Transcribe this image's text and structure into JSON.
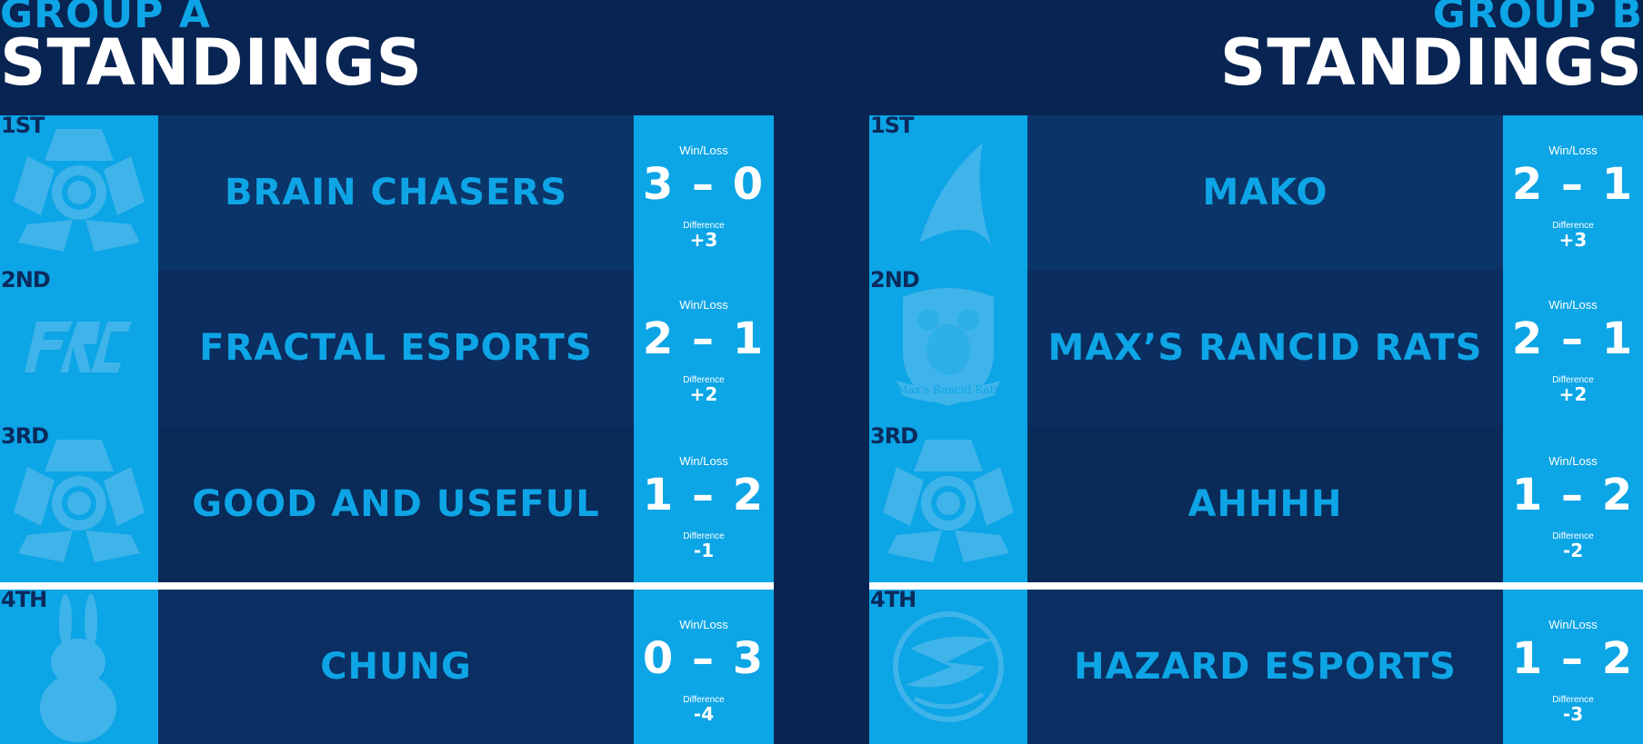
{
  "group_a": {
    "subtitle": "GROUP A",
    "title": "STANDINGS",
    "standings": [
      {
        "rank": "1ST",
        "team": "BRAIN CHASERS",
        "wl_label": "Win/Loss",
        "wins": "3",
        "losses": "0",
        "diff_label": "Difference",
        "diff": "+3",
        "logo_icon": "rocket-league-logo-icon"
      },
      {
        "rank": "2ND",
        "team": "FRACTAL ESPORTS",
        "wl_label": "Win/Loss",
        "wins": "2",
        "losses": "1",
        "diff_label": "Difference",
        "diff": "+2",
        "logo_icon": "frc-logo-icon"
      },
      {
        "rank": "3RD",
        "team": "GOOD AND USEFUL",
        "wl_label": "Win/Loss",
        "wins": "1",
        "losses": "2",
        "diff_label": "Difference",
        "diff": "-1",
        "logo_icon": "rocket-league-logo-icon"
      },
      {
        "rank": "4TH",
        "team": "CHUNG",
        "wl_label": "Win/Loss",
        "wins": "0",
        "losses": "3",
        "diff_label": "Difference",
        "diff": "-4",
        "logo_icon": "chungus-rabbit-logo-icon"
      }
    ]
  },
  "group_b": {
    "subtitle": "GROUP B",
    "title": "STANDINGS",
    "standings": [
      {
        "rank": "1ST",
        "team": "MAKO",
        "wl_label": "Win/Loss",
        "wins": "2",
        "losses": "1",
        "diff_label": "Difference",
        "diff": "+3",
        "logo_icon": "shark-fin-logo-icon"
      },
      {
        "rank": "2ND",
        "team": "MAX’S RANCID RATS",
        "wl_label": "Win/Loss",
        "wins": "2",
        "losses": "1",
        "diff_label": "Difference",
        "diff": "+2",
        "logo_icon": "rat-crest-logo-icon"
      },
      {
        "rank": "3RD",
        "team": "AHHHH",
        "wl_label": "Win/Loss",
        "wins": "1",
        "losses": "2",
        "diff_label": "Difference",
        "diff": "-2",
        "logo_icon": "rocket-league-logo-icon"
      },
      {
        "rank": "4TH",
        "team": "HAZARD ESPORTS",
        "wl_label": "Win/Loss",
        "wins": "1",
        "losses": "2",
        "diff_label": "Difference",
        "diff": "-3",
        "logo_icon": "hazard-logo-icon"
      }
    ]
  },
  "logo_text": {
    "rats_banner": "Max's Rancid Rats"
  },
  "colors": {
    "background": "#082453",
    "accent": "#0ca5e6",
    "rank": "#0b2a5c",
    "row_dark": "#0b2f62"
  }
}
